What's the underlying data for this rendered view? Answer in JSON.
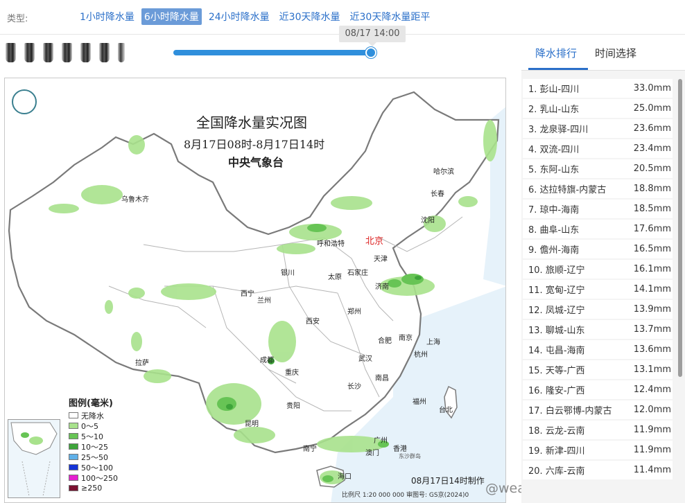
{
  "type_bar": {
    "label": "类型:",
    "tabs": [
      {
        "label": "1小时降水量",
        "active": false
      },
      {
        "label": "6小时降水量",
        "active": true
      },
      {
        "label": "24小时降水量",
        "active": false
      },
      {
        "label": "近30天降水量",
        "active": false
      },
      {
        "label": "近30天降水量距平",
        "active": false
      }
    ]
  },
  "timeline": {
    "current_time": "08/17 14:00",
    "progress": 1.0
  },
  "map": {
    "title": "全国降水量实况图",
    "subtitle": "8月17日08时-8月17日14时",
    "issuer": "中央气象台",
    "legend": {
      "title": "图例(毫米)",
      "items": [
        {
          "label": "无降水",
          "color": "#ffffff"
        },
        {
          "label": "0～5",
          "color": "#a8e28c"
        },
        {
          "label": "5～10",
          "color": "#67c455"
        },
        {
          "label": "10～25",
          "color": "#3ea43a"
        },
        {
          "label": "25～50",
          "color": "#5fb0e8"
        },
        {
          "label": "50～100",
          "color": "#1533d6"
        },
        {
          "label": "100～250",
          "color": "#e51fd0"
        },
        {
          "label": "≥250",
          "color": "#7a1030"
        }
      ]
    },
    "cities": [
      {
        "name": "乌鲁木齐",
        "kind": "city"
      },
      {
        "name": "哈尔滨",
        "kind": "city"
      },
      {
        "name": "长春",
        "kind": "city"
      },
      {
        "name": "沈阳",
        "kind": "city"
      },
      {
        "name": "呼和浩特",
        "kind": "city"
      },
      {
        "name": "北京",
        "kind": "capital"
      },
      {
        "name": "天津",
        "kind": "city"
      },
      {
        "name": "银川",
        "kind": "city"
      },
      {
        "name": "太原",
        "kind": "city"
      },
      {
        "name": "石家庄",
        "kind": "city"
      },
      {
        "name": "济南",
        "kind": "city"
      },
      {
        "name": "西宁",
        "kind": "city"
      },
      {
        "name": "兰州",
        "kind": "city"
      },
      {
        "name": "郑州",
        "kind": "city"
      },
      {
        "name": "西安",
        "kind": "city"
      },
      {
        "name": "合肥",
        "kind": "city"
      },
      {
        "name": "南京",
        "kind": "city"
      },
      {
        "name": "上海",
        "kind": "city"
      },
      {
        "name": "拉萨",
        "kind": "city"
      },
      {
        "name": "成都",
        "kind": "city"
      },
      {
        "name": "武汉",
        "kind": "city"
      },
      {
        "name": "杭州",
        "kind": "city"
      },
      {
        "name": "重庆",
        "kind": "city"
      },
      {
        "name": "南昌",
        "kind": "city"
      },
      {
        "name": "长沙",
        "kind": "city"
      },
      {
        "name": "贵阳",
        "kind": "city"
      },
      {
        "name": "福州",
        "kind": "city"
      },
      {
        "name": "台北",
        "kind": "city"
      },
      {
        "name": "昆明",
        "kind": "city"
      },
      {
        "name": "广州",
        "kind": "city"
      },
      {
        "name": "南宁",
        "kind": "city"
      },
      {
        "name": "香港",
        "kind": "city"
      },
      {
        "name": "澳门",
        "kind": "city"
      },
      {
        "name": "海口",
        "kind": "city"
      },
      {
        "name": "东沙群岛",
        "kind": "small"
      }
    ],
    "footer_scale": "比例尺 1:20 000 000    审图号: GS京(2024)0",
    "footer_time": "08月17日14时制作",
    "watermark": "@weatherman_信欣",
    "colors": {
      "light_green": "#a8e28c",
      "mid_green": "#67c455",
      "dark_green": "#3ea43a",
      "border": "#7a7a7a",
      "province_border": "#b5b5b5",
      "sea": "#e6f2fa"
    }
  },
  "right_panel": {
    "tabs": [
      {
        "label": "降水排行",
        "active": true
      },
      {
        "label": "时间选择",
        "active": false
      }
    ],
    "ranking": [
      {
        "rank": "1.",
        "station": "彭山-四川",
        "value": "33.0mm"
      },
      {
        "rank": "2.",
        "station": "乳山-山东",
        "value": "25.0mm"
      },
      {
        "rank": "3.",
        "station": "龙泉驿-四川",
        "value": "23.6mm"
      },
      {
        "rank": "4.",
        "station": "双流-四川",
        "value": "23.4mm"
      },
      {
        "rank": "5.",
        "station": "东阿-山东",
        "value": "20.5mm"
      },
      {
        "rank": "6.",
        "station": "达拉特旗-内蒙古",
        "value": "18.8mm"
      },
      {
        "rank": "7.",
        "station": "琼中-海南",
        "value": "18.5mm"
      },
      {
        "rank": "8.",
        "station": "曲阜-山东",
        "value": "17.6mm"
      },
      {
        "rank": "9.",
        "station": "儋州-海南",
        "value": "16.5mm"
      },
      {
        "rank": "10.",
        "station": "旅顺-辽宁",
        "value": "16.1mm"
      },
      {
        "rank": "11.",
        "station": "宽甸-辽宁",
        "value": "14.1mm"
      },
      {
        "rank": "12.",
        "station": "凤城-辽宁",
        "value": "13.9mm"
      },
      {
        "rank": "13.",
        "station": "聊城-山东",
        "value": "13.7mm"
      },
      {
        "rank": "14.",
        "station": "屯昌-海南",
        "value": "13.6mm"
      },
      {
        "rank": "15.",
        "station": "天等-广西",
        "value": "13.1mm"
      },
      {
        "rank": "16.",
        "station": "隆安-广西",
        "value": "12.4mm"
      },
      {
        "rank": "17.",
        "station": "白云鄂博-内蒙古",
        "value": "12.0mm"
      },
      {
        "rank": "18.",
        "station": "云龙-云南",
        "value": "11.9mm"
      },
      {
        "rank": "19.",
        "station": "新津-四川",
        "value": "11.9mm"
      },
      {
        "rank": "20.",
        "station": "六库-云南",
        "value": "11.4mm"
      }
    ]
  }
}
